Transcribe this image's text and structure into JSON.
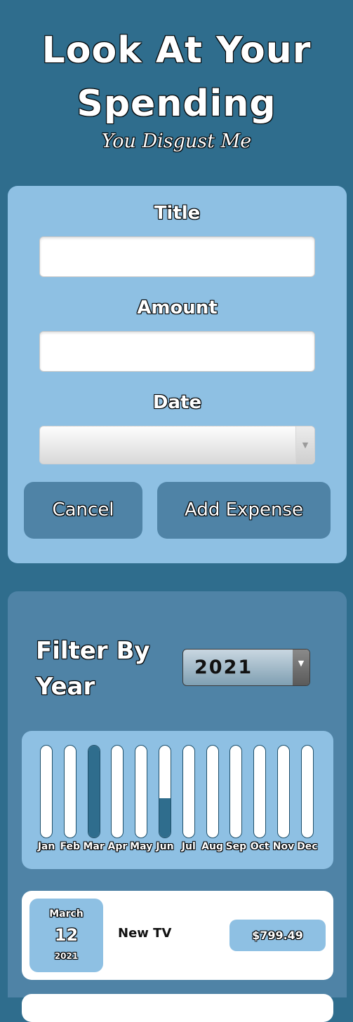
{
  "header": {
    "title": "Look At Your Spending",
    "subtitle": "You Disgust Me"
  },
  "form": {
    "title_label": "Title",
    "title_value": "",
    "amount_label": "Amount",
    "amount_value": "",
    "date_label": "Date",
    "date_value": "",
    "cancel_label": "Cancel",
    "add_label": "Add Expense"
  },
  "filter": {
    "label": "Filter By Year",
    "selected_year": "2021"
  },
  "chart_data": {
    "type": "bar",
    "categories": [
      "Jan",
      "Feb",
      "Mar",
      "Apr",
      "May",
      "Jun",
      "Jul",
      "Aug",
      "Sep",
      "Oct",
      "Nov",
      "Dec"
    ],
    "values": [
      0,
      0,
      1,
      0,
      0,
      0.42,
      0,
      0,
      0,
      0,
      0,
      0
    ],
    "ylim": [
      0,
      1
    ]
  },
  "expenses": [
    {
      "month": "March",
      "day": "12",
      "year": "2021",
      "title": "New TV",
      "amount": "$799.49"
    }
  ],
  "colors": {
    "background": "#2f6d8d",
    "card_light": "#8ec0e3",
    "card_dark": "#4f83a6",
    "bar_fill": "#2f6d8d"
  }
}
